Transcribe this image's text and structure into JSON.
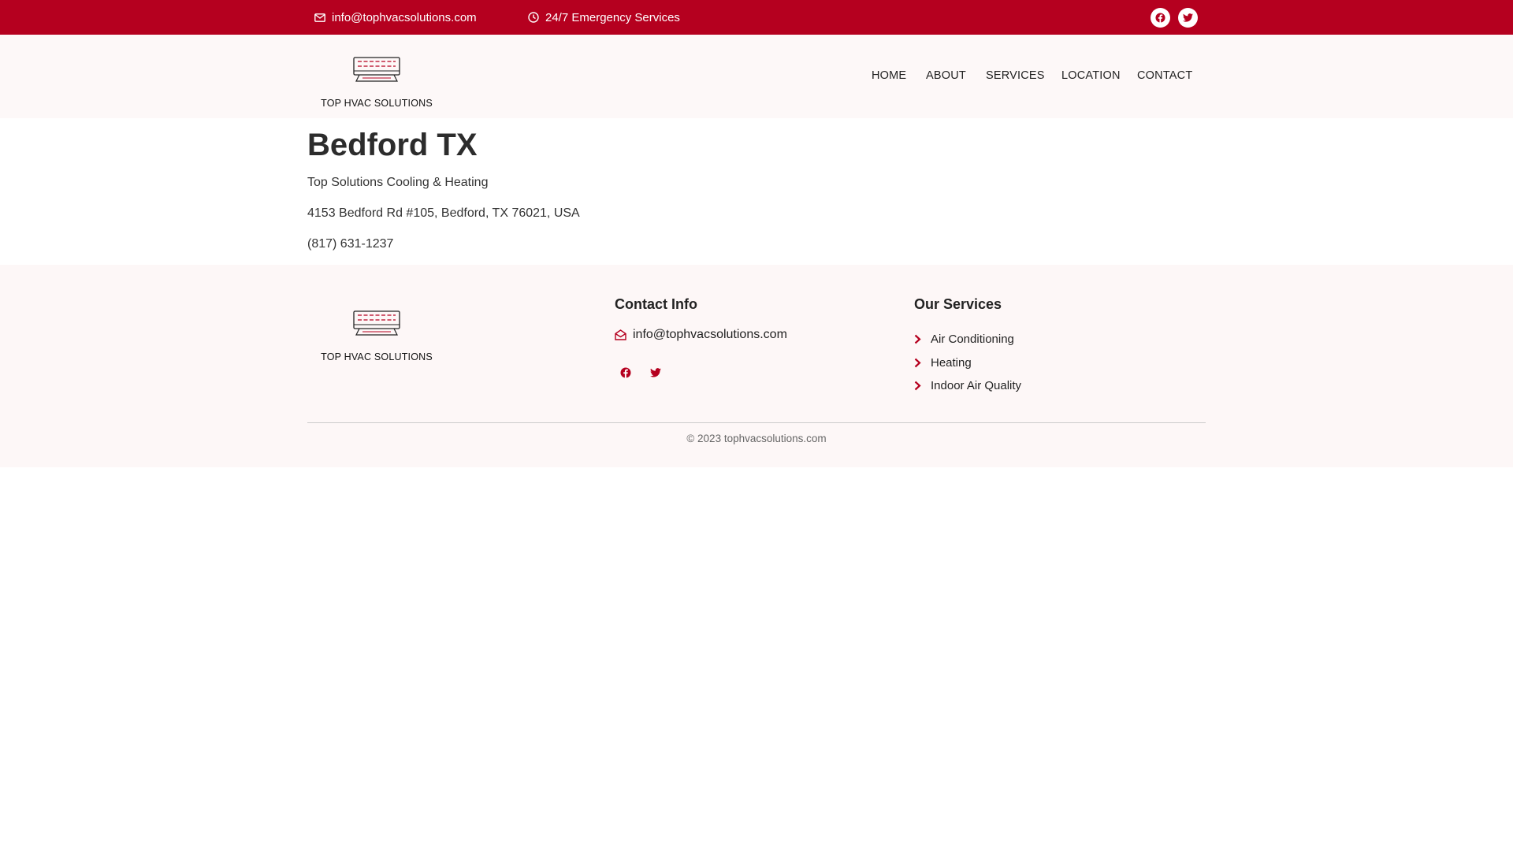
{
  "topbar": {
    "email": "info@tophvacsolutions.com",
    "emergency": "24/7 Emergency Services",
    "icons": [
      "envelope-icon",
      "clock-icon",
      "facebook-icon",
      "twitter-icon"
    ]
  },
  "header": {
    "logo_text": "TOP HVAC SOLUTIONS",
    "nav": [
      "HOME",
      "ABOUT",
      "SERVICES",
      "LOCATION",
      "CONTACT"
    ]
  },
  "main": {
    "title": "Bedford TX",
    "business_name": "Top Solutions Cooling & Heating",
    "address": "4153 Bedford Rd #105, Bedford, TX 76021, USA",
    "phone": "(817) 631-1237"
  },
  "footer": {
    "logo_text": "TOP HVAC SOLUTIONS",
    "contact_heading": "Contact Info",
    "contact_email": "info@tophvacsolutions.com",
    "services_heading": "Our Services",
    "services": [
      "Air Conditioning",
      "Heating",
      "Indoor Air Quality"
    ],
    "copyright": "© 2023 tophvacsolutions.com"
  },
  "colors": {
    "brand_red": "#b5001f",
    "header_bg": "#fdf8f8",
    "footer_bg": "#fdf7f7"
  }
}
